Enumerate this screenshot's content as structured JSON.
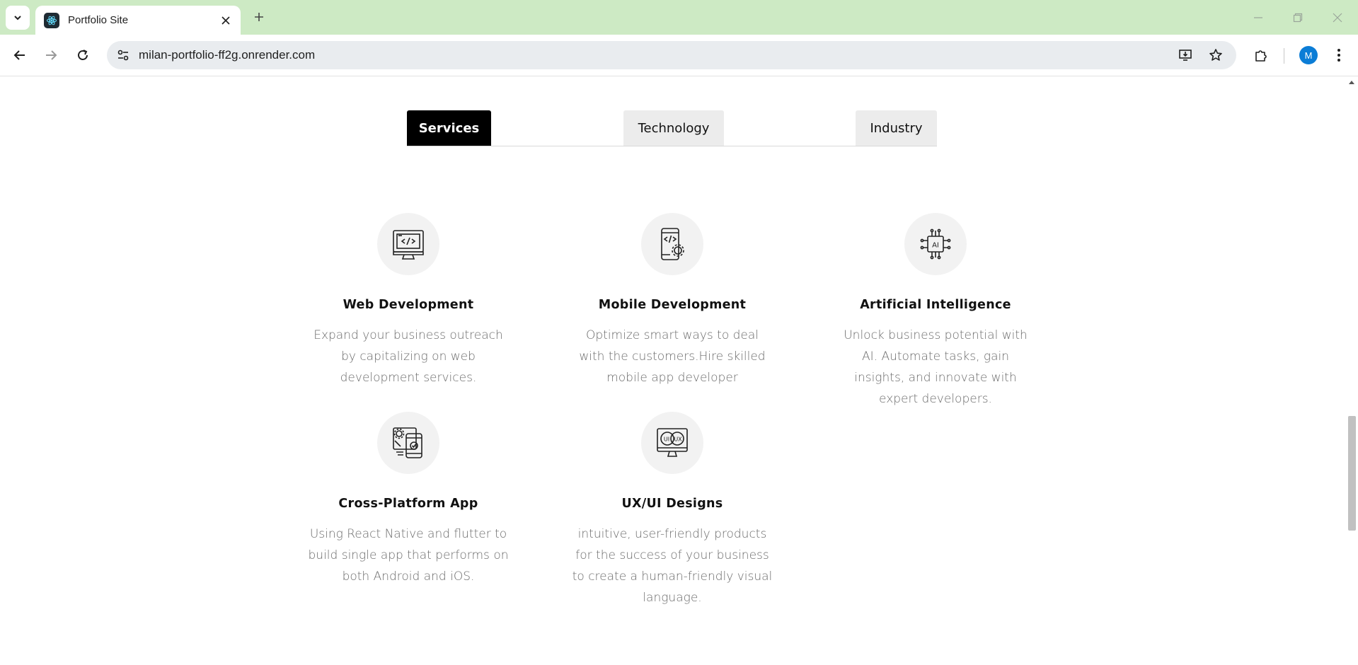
{
  "browser": {
    "tab_title": "Portfolio Site",
    "url": "milan-portfolio-ff2g.onrender.com",
    "profile_initial": "M",
    "accent_color": "#0b7dd6",
    "tabbar_color": "#cdeac4"
  },
  "tabs": {
    "services_label": "Services",
    "technology_label": "Technology",
    "industry_label": "Industry",
    "active": "Services"
  },
  "services": [
    {
      "icon": "web-development-icon",
      "title": "Web Development",
      "description": "Expand your business outreach by capitalizing on web development services."
    },
    {
      "icon": "mobile-development-icon",
      "title": "Mobile Development",
      "description": "Optimize smart ways to deal with the customers.Hire skilled mobile app developer"
    },
    {
      "icon": "artificial-intelligence-icon",
      "title": "Artificial Intelligence",
      "description": "Unlock business potential with AI. Automate tasks, gain insights, and innovate with expert developers."
    },
    {
      "icon": "cross-platform-icon",
      "title": "Cross-Platform App",
      "description": "Using React Native and flutter to build single app that performs on both Android and iOS."
    },
    {
      "icon": "ux-ui-design-icon",
      "title": "UX/UI Designs",
      "description": "intuitive, user-friendly products for the success of your business to create a human-friendly visual language."
    }
  ]
}
